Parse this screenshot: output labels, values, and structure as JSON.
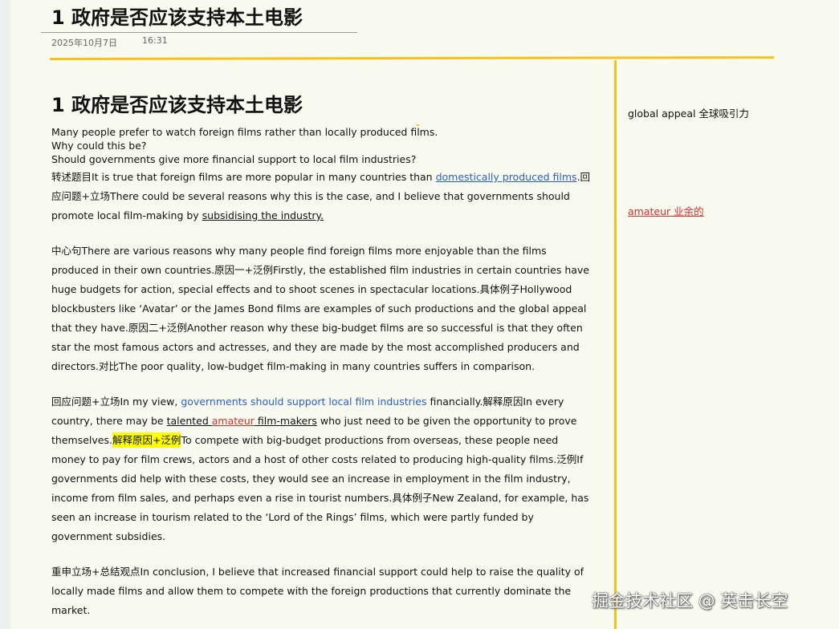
{
  "header": {
    "title": "1 政府是否应该支持本土电影",
    "date": "2025年10月7日",
    "time": "16:31"
  },
  "essay": {
    "heading": "1 政府是否应该支持本土电影",
    "question": {
      "line1": "Many people prefer to watch foreign films rather than locally produced films.",
      "line2": "Why could this be?",
      "line3": "Should governments give more financial support to local film industries?"
    },
    "p1": {
      "a": "转述题目It is true that foreign films are more popular in many countries than ",
      "link": "domestically produced films",
      "b": ".回应问题+立场There could be several reasons why this is the case, and I believe that governments should promote local film-making by ",
      "underlined": "subsidising the industry."
    },
    "p2": {
      "text": "中心句There are various reasons why many people find foreign films more enjoyable than the films produced in their own countries.原因一+泛例Firstly, the established film industries in certain countries have huge budgets for action, special effects and to shoot scenes in spectacular locations.具体例子Hollywood blockbusters like ‘Avatar’ or the James Bond films are examples of such productions and the global appeal that they have.原因二+泛例Another reason why these big-budget films are so successful is that they often star the most famous actors and actresses, and they are made by the most accomplished producers and directors.对比The poor quality, low-budget film-making in many countries suffers in comparison."
    },
    "p3": {
      "a": "回应问题+立场In my view, ",
      "blue": "governments should support local film industries",
      "b": " financially.解释原因In every country, there may be ",
      "talented": "talented ",
      "amateur": "amateur",
      "filmmakers": " film-makers",
      "c": " who just need to be given the opportunity to prove themselves.",
      "highlight": "解释原因+泛例",
      "d": "To compete with big-budget productions from overseas, these people need money to pay for film crews, actors and a host of other costs related to producing high-quality films.泛例If governments did help with these costs, they would see an increase in employment in the film industry, income from film sales, and perhaps even a rise in tourist numbers.具体例子New Zealand, for example, has seen an increase in tourism related to the ‘Lord of the Rings’ films, which were partly funded by government subsidies."
    },
    "p4": {
      "text": "重申立场+总结观点In conclusion, I believe that increased financial support could help to raise the quality of locally made films and allow them to compete with the foreign productions that currently dominate the market."
    }
  },
  "sidebar": {
    "note1": "global appeal 全球吸引力",
    "note2": "amateur 业余的"
  },
  "watermark": "掘金技术社区 @ 英击长空",
  "colors": {
    "accent": "#f5c21d",
    "link": "#2a5fc9",
    "red": "#d0312d",
    "highlight": "#ffff00",
    "background": "#f8faef"
  }
}
